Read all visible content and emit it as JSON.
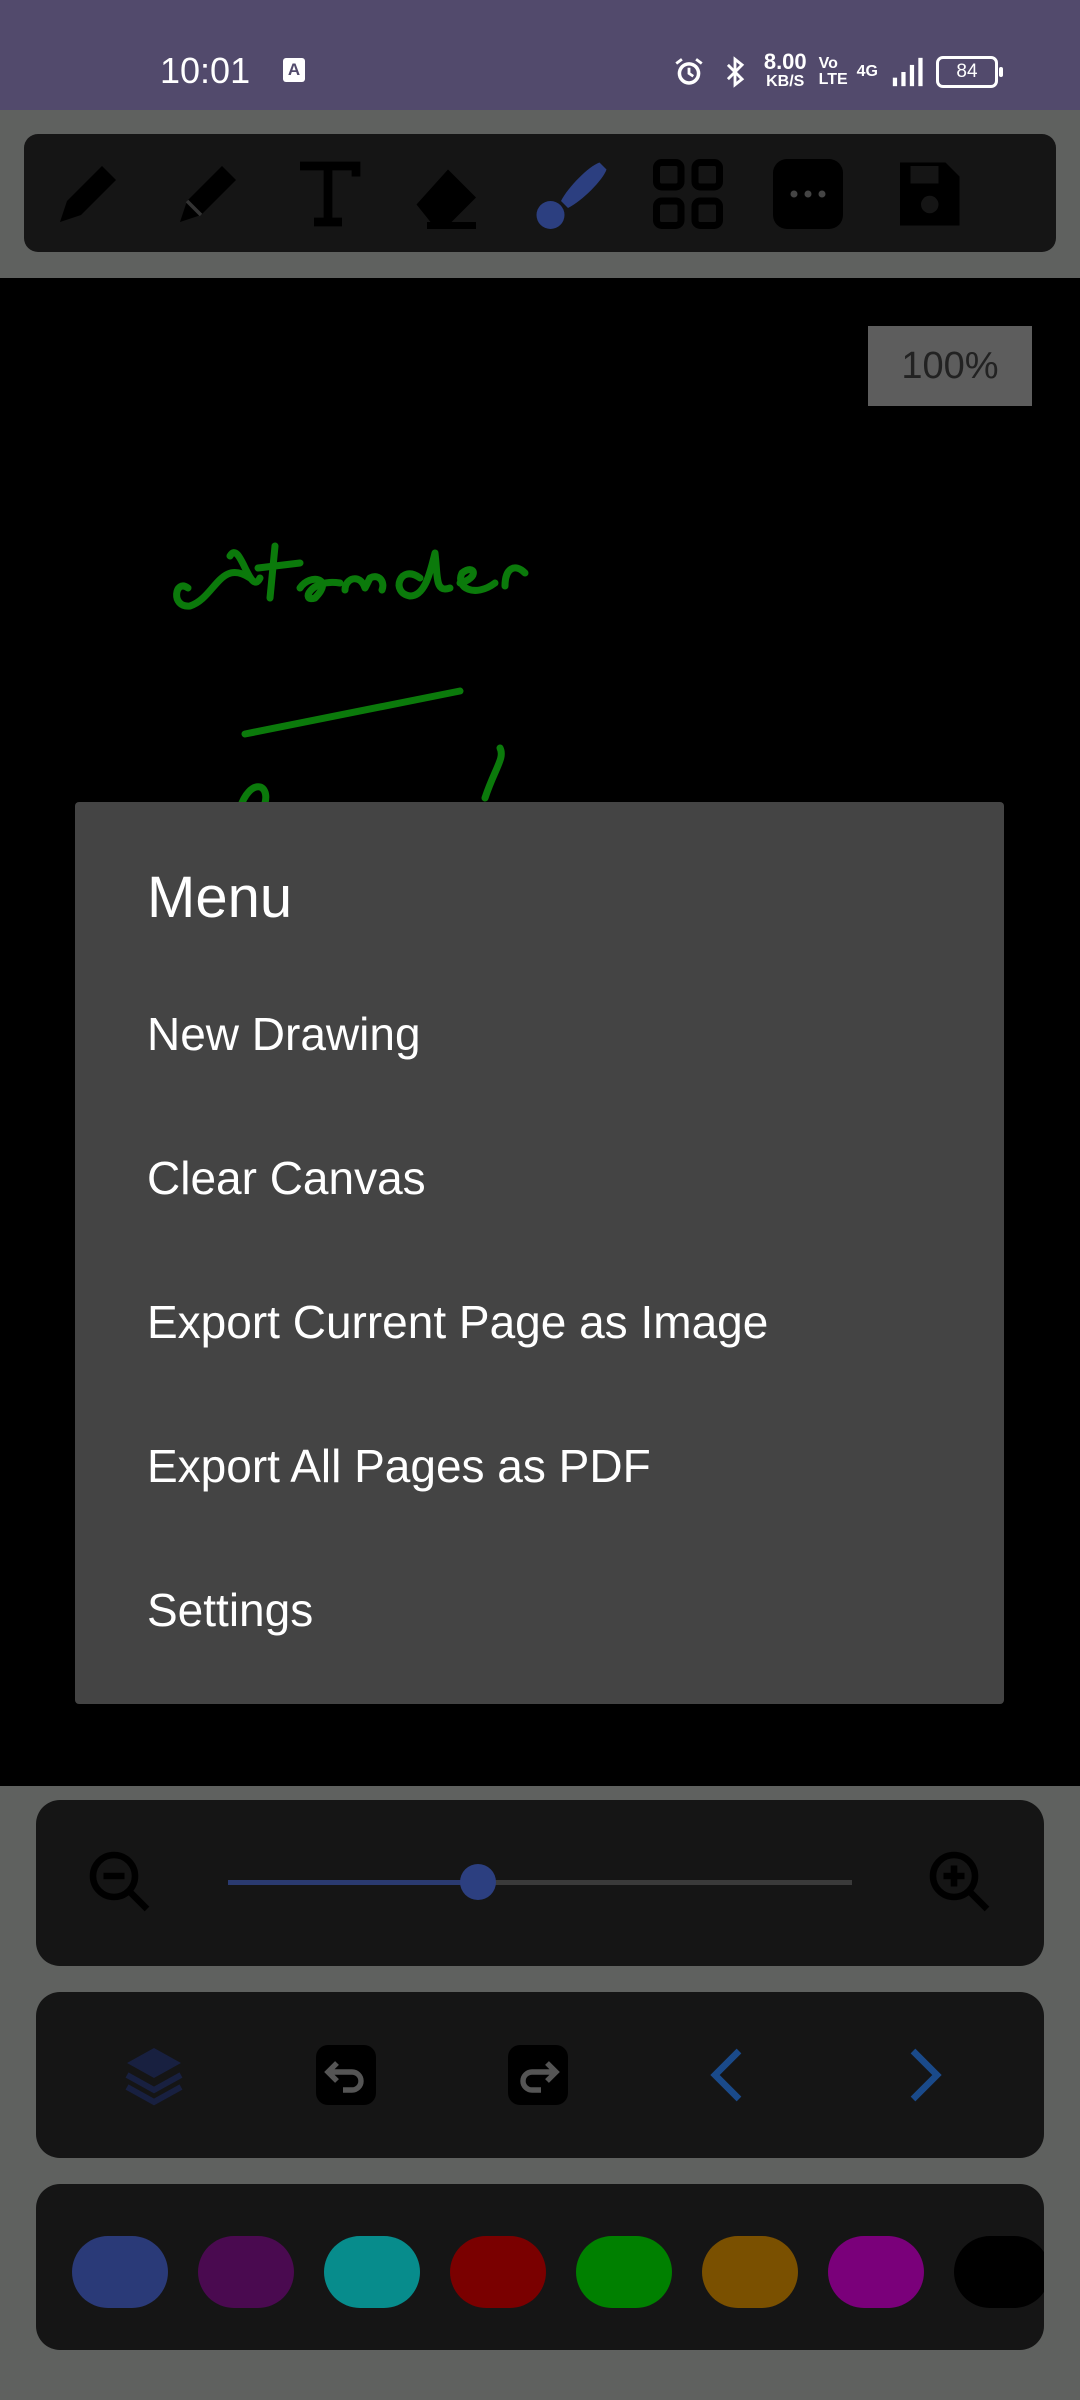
{
  "status": {
    "time": "10:01",
    "a_badge": "A",
    "speed_value": "8.00",
    "speed_unit": "KB/S",
    "volte": "Vo LTE",
    "network": "4G",
    "battery": "84"
  },
  "toolbar": {
    "tools": [
      "pen-icon",
      "pencil-icon",
      "text-icon",
      "eraser-icon",
      "brush-icon",
      "grid-icon",
      "more-icon",
      "save-icon"
    ],
    "active_tool": "brush-icon",
    "accent": "#2c3f80"
  },
  "canvas": {
    "zoom_label": "100%",
    "ink_color": "#0b7a0b"
  },
  "menu": {
    "title": "Menu",
    "items": [
      "New Drawing",
      "Clear Canvas",
      "Export Current Page as Image",
      "Export All Pages as PDF",
      "Settings"
    ]
  },
  "zoom": {
    "level": 0.4,
    "out_icon": "zoom-out-icon",
    "in_icon": "zoom-in-icon"
  },
  "nav": {
    "icons": [
      "layers-icon",
      "undo-icon",
      "redo-icon",
      "chevron-left-icon",
      "chevron-right-icon"
    ]
  },
  "palette": {
    "colors": [
      "#2a3a78",
      "#4a0a50",
      "#078c8c",
      "#7a0000",
      "#008000",
      "#7a5000",
      "#7a007a",
      "#000000"
    ]
  }
}
